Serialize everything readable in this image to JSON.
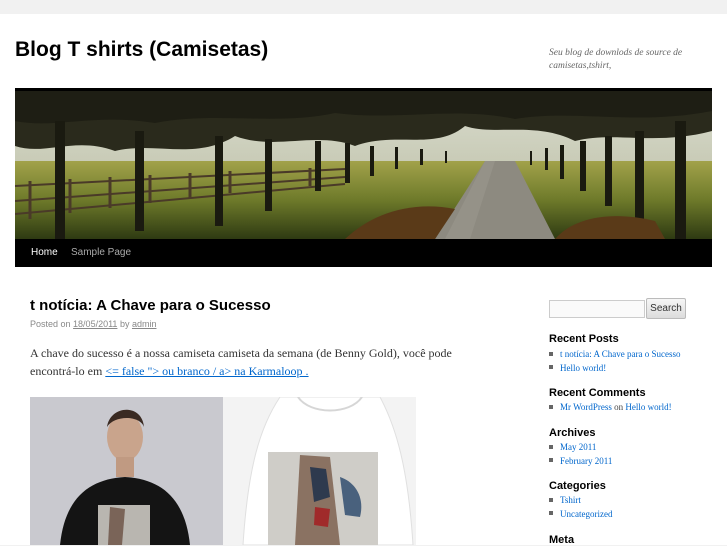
{
  "site": {
    "title": "Blog T shirts (Camisetas)",
    "description": "Seu blog de downlods de source de camisetas,tshirt,"
  },
  "menu": {
    "items": [
      {
        "label": "Home"
      },
      {
        "label": "Sample Page"
      }
    ]
  },
  "post": {
    "title": "t notícia: A Chave para o Sucesso",
    "posted_on": "Posted on",
    "date": "18/05/2011",
    "by": "by",
    "author": "admin",
    "body_text": "A chave do sucesso é a nossa camiseta camiseta da semana (de Benny Gold), você pode encontrá-lo em",
    "link_text": "<= false \"> ou branco / a> na Karmaloop ."
  },
  "sidebar": {
    "search": {
      "placeholder": "",
      "button_label": "Search"
    },
    "recent_posts": {
      "title": "Recent Posts",
      "items": [
        "t notícia: A Chave para o Sucesso",
        "Hello world!"
      ]
    },
    "recent_comments": {
      "title": "Recent Comments",
      "author": "Mr WordPress",
      "on": "on",
      "post": "Hello world!"
    },
    "archives": {
      "title": "Archives",
      "items": [
        "May 2011",
        "February 2011"
      ]
    },
    "categories": {
      "title": "Categories",
      "items": [
        "Tshirt",
        "Uncategorized"
      ]
    },
    "meta": {
      "title": "Meta"
    }
  },
  "colors": {
    "link": "#0066cc",
    "menu_bar": "#000000",
    "page_bg": "#f1f1f1"
  }
}
